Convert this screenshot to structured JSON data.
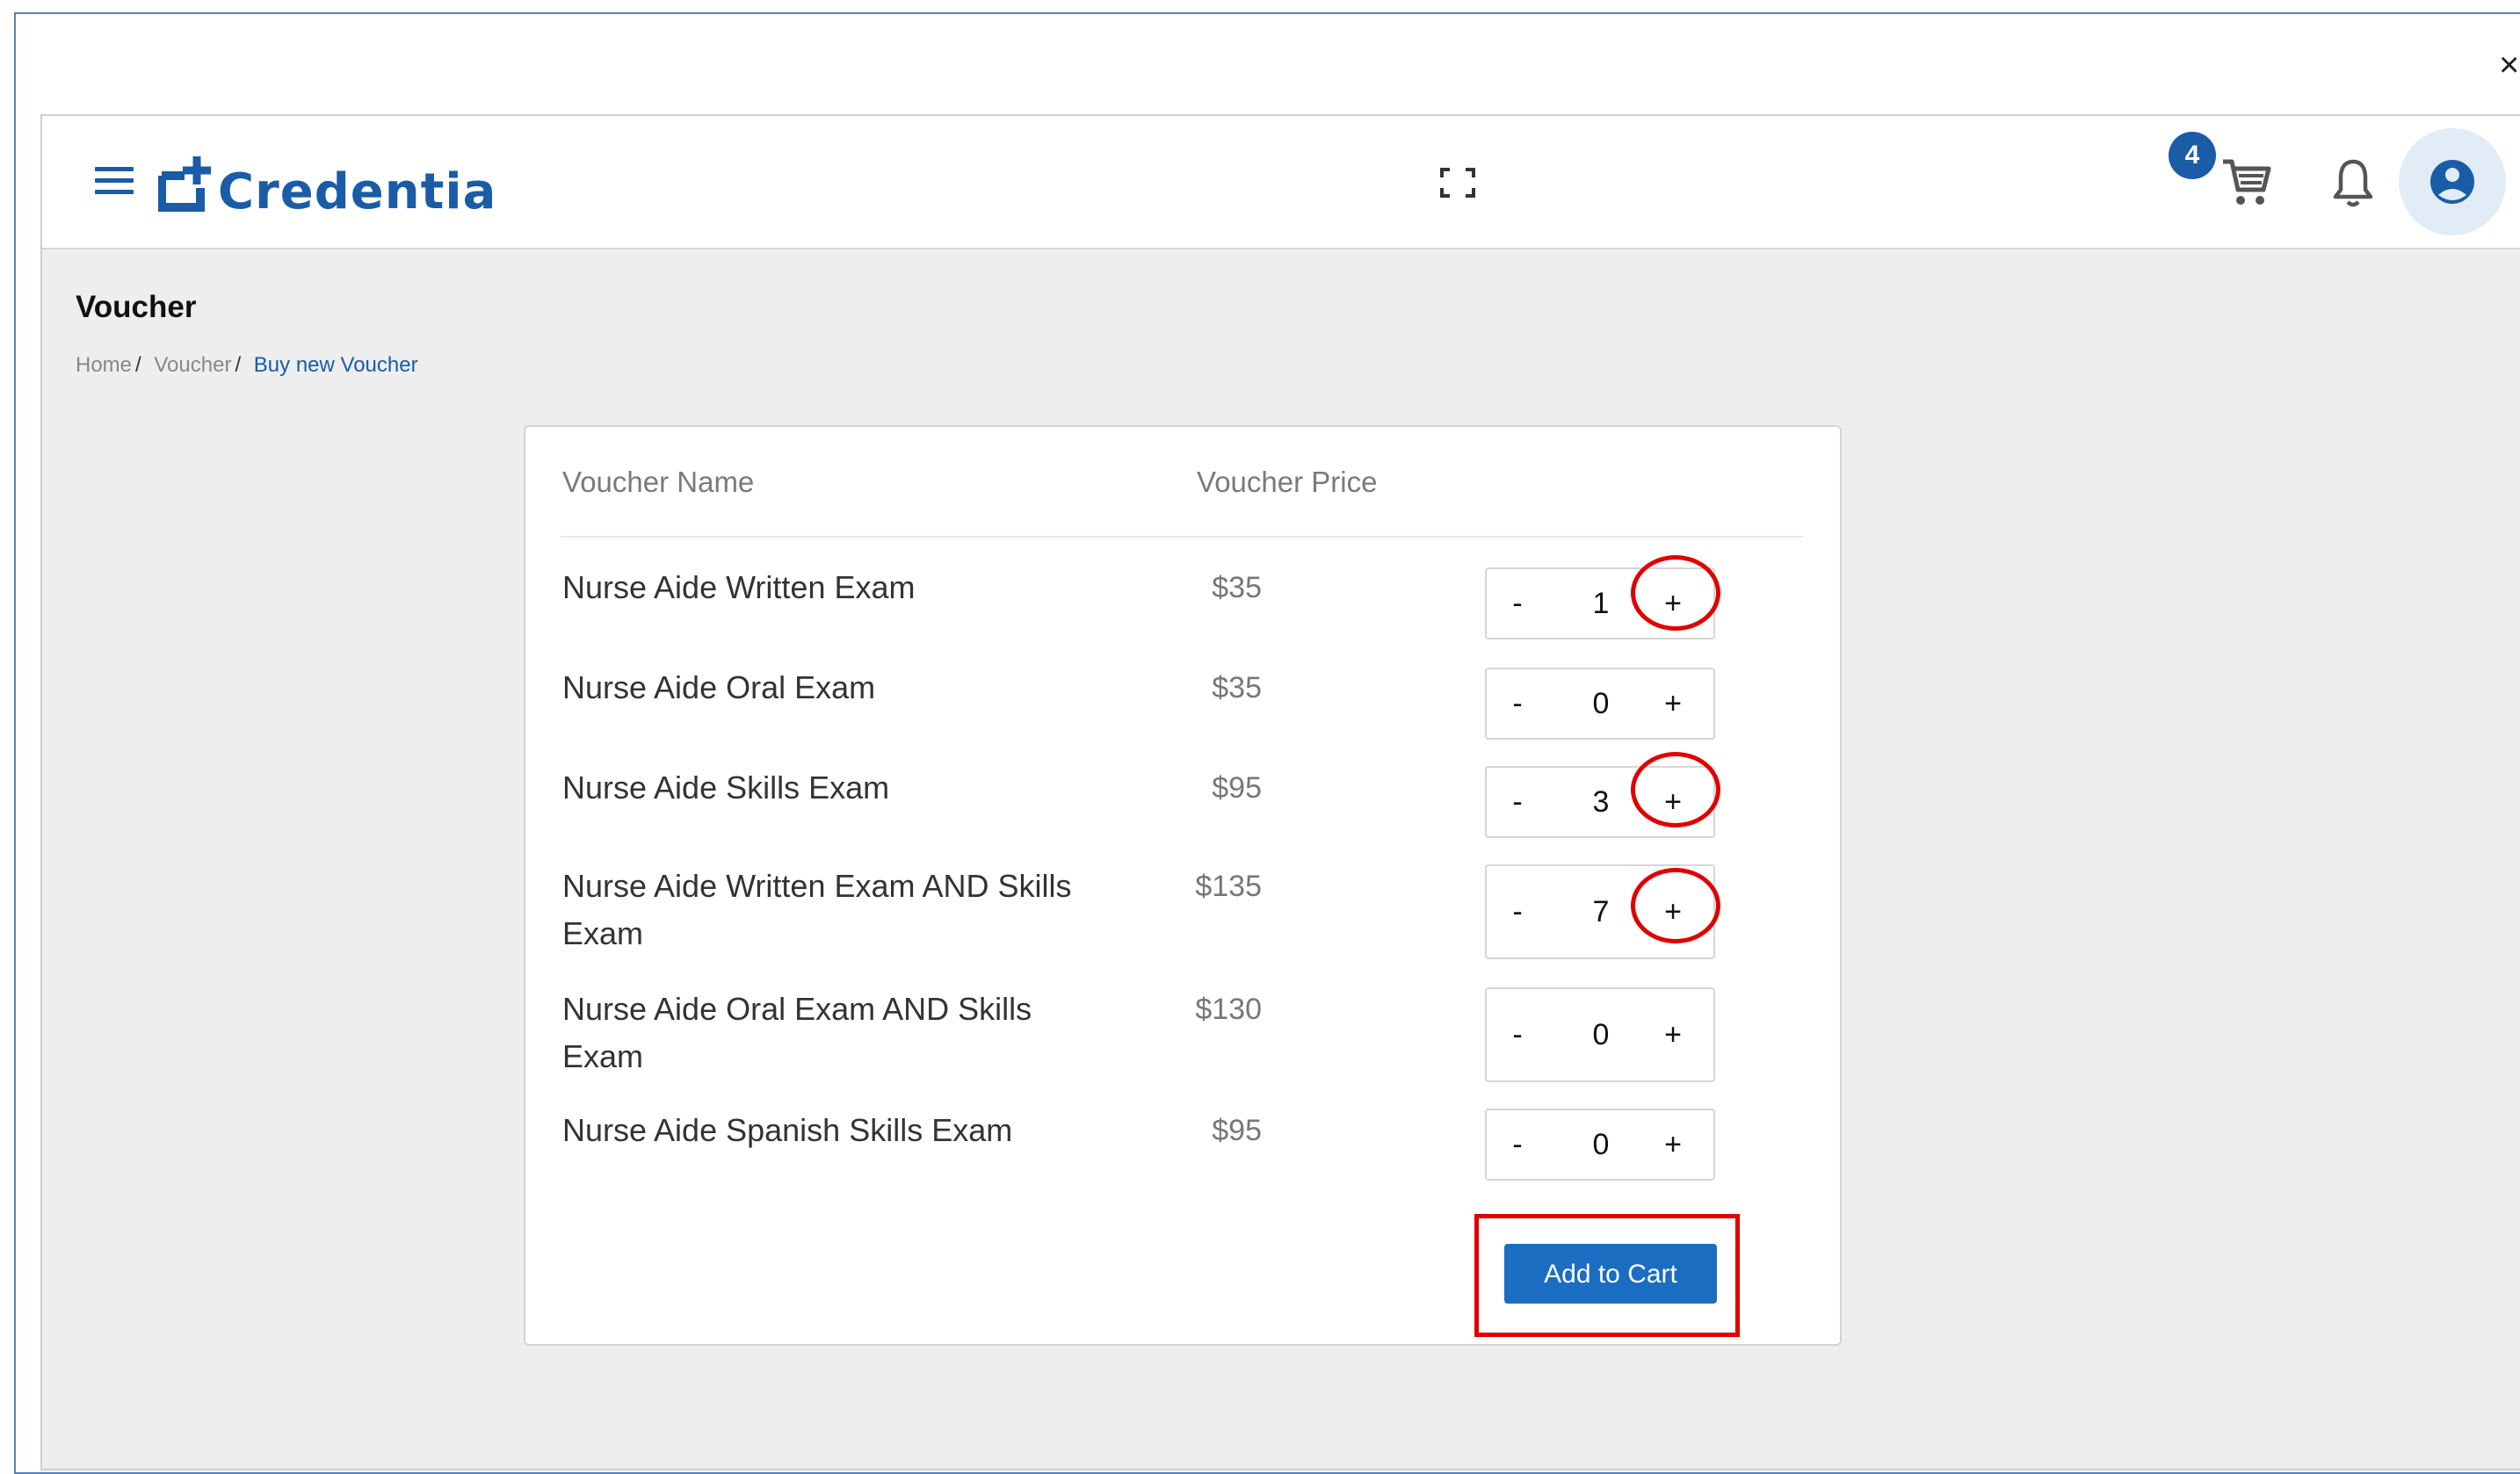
{
  "app": {
    "brand": "Credentia",
    "cart_count": "4",
    "close_glyph": "×"
  },
  "page": {
    "title": "Voucher",
    "breadcrumb": [
      {
        "label": "Home",
        "sep": "/"
      },
      {
        "label": "Voucher",
        "sep": "/"
      },
      {
        "label": "Buy new Voucher"
      }
    ]
  },
  "table": {
    "col_name": "Voucher Name",
    "col_price": "Voucher Price",
    "rows": [
      {
        "name": "Nurse Aide Written Exam",
        "price": "$35",
        "qty": "1"
      },
      {
        "name": "Nurse Aide Oral Exam",
        "price": "$35",
        "qty": "0"
      },
      {
        "name": "Nurse Aide Skills Exam",
        "price": "$95",
        "qty": "3"
      },
      {
        "name": "Nurse Aide Written Exam AND Skills Exam",
        "price": "$135",
        "qty": "7"
      },
      {
        "name": "Nurse Aide Oral Exam AND Skills Exam",
        "price": "$130",
        "qty": "0"
      },
      {
        "name": "Nurse Aide Spanish Skills Exam",
        "price": "$95",
        "qty": "0"
      }
    ],
    "minus_label": "-",
    "plus_label": "+"
  },
  "actions": {
    "add_to_cart": "Add to Cart"
  },
  "icons": [
    "menu-icon",
    "fullscreen-icon",
    "cart-icon",
    "bell-icon",
    "user-account-icon",
    "close-icon"
  ],
  "colors": {
    "brand": "#1a5ca6",
    "button": "#1a6dc0",
    "highlight": "#e00000",
    "background": "#eeeeee"
  }
}
